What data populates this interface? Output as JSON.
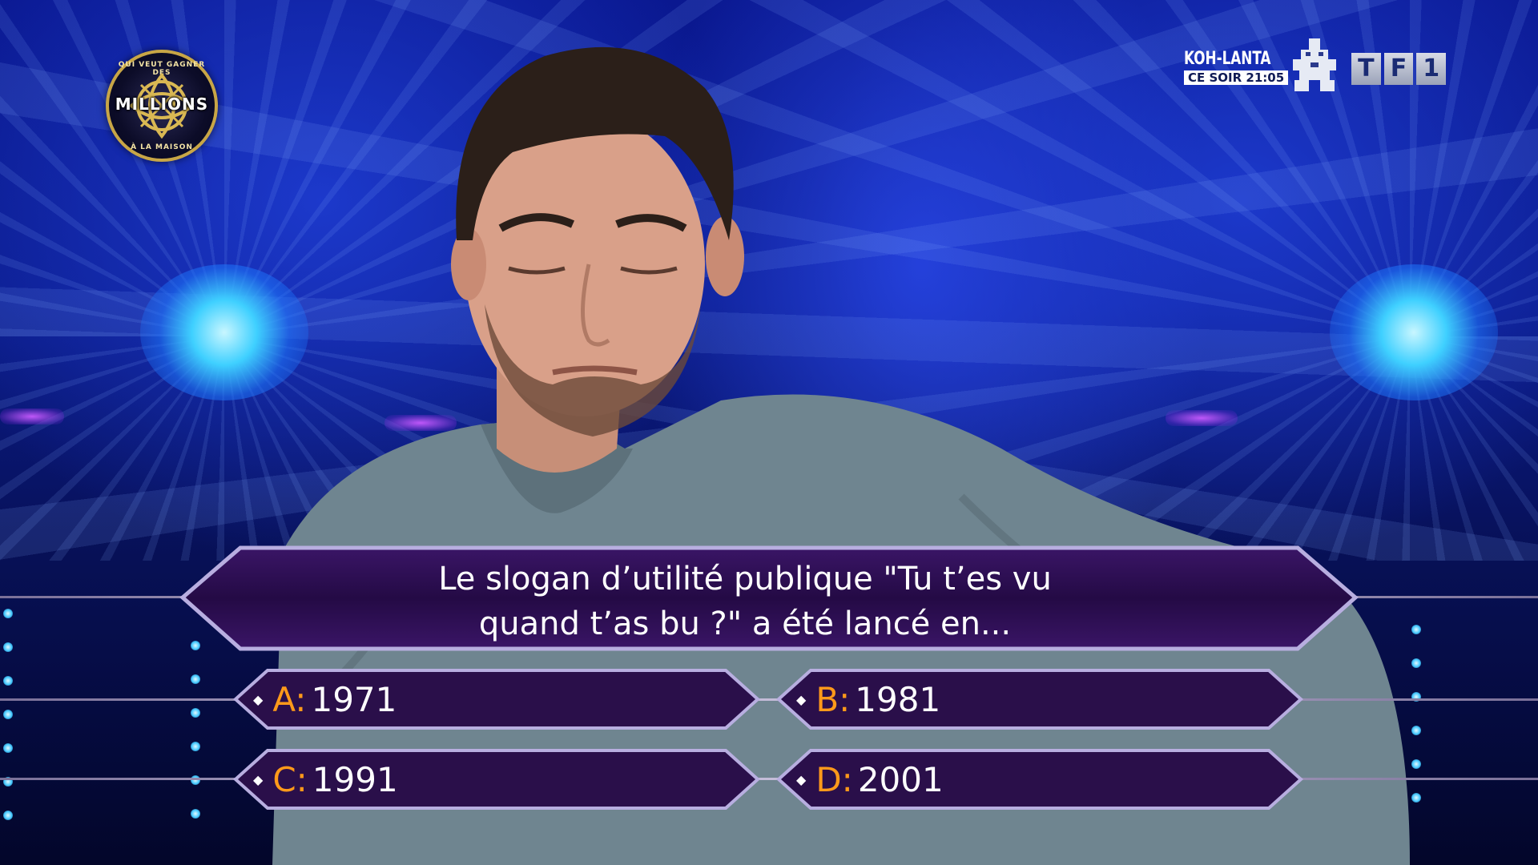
{
  "show_logo": {
    "ring_top": "QUI VEUT GAGNER DES",
    "name": "MILLIONS",
    "ring_bottom": "À LA MAISON"
  },
  "promo": {
    "title": "KOH-LANTA",
    "time": "CE SOIR 21:05"
  },
  "channel": {
    "letters": [
      "T",
      "F",
      "1"
    ]
  },
  "question": {
    "line1": "Le slogan d’utilité publique \"Tu t’es vu",
    "line2": "quand t’as bu ?\" a été lancé en..."
  },
  "answers": [
    {
      "letter": "A:",
      "text": "1971"
    },
    {
      "letter": "B:",
      "text": "1981"
    },
    {
      "letter": "C:",
      "text": "1991"
    },
    {
      "letter": "D:",
      "text": "2001"
    }
  ],
  "colors": {
    "answer_letter": "#ff9a1a",
    "panel_fill": "#2a0f4a",
    "panel_border": "#b8aee0",
    "stage_blue": "#0b1c8c"
  }
}
